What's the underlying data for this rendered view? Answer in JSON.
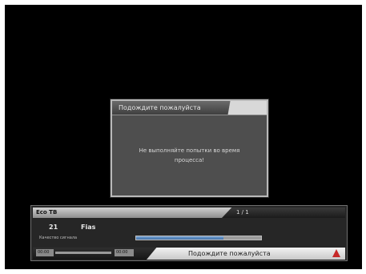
{
  "dialog": {
    "title": "Подождите пожалуйста",
    "message_line1": "Не выполняйте попытки во время",
    "message_line2": "процесса!"
  },
  "infobar": {
    "satellite": "Eco TB",
    "tab_label": "1 / 1",
    "channel_number": "21",
    "channel_name": "Fias",
    "quality_label": "Качество сигнала",
    "quality_level": 0.7,
    "footer_left_1": "00:00",
    "footer_left_2": "00:00",
    "footer_status": "Подождите пожалуйста",
    "status_icon": "warning-arrow-icon",
    "colors": {
      "accent": "#c62828",
      "quality_bar": "#3f6fa8"
    }
  }
}
